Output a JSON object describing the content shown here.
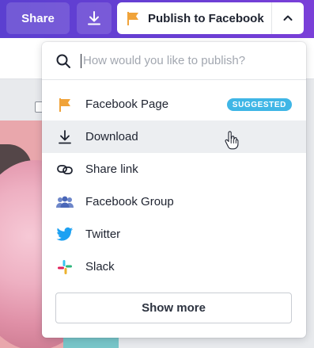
{
  "toolbar": {
    "share_label": "Share",
    "download_icon": "download-icon",
    "publish_label": "Publish to Facebook",
    "publish_icon": "flag-icon",
    "toggle_icon": "chevron-up-icon",
    "accent_color": "#6a3fd4"
  },
  "dropdown": {
    "search": {
      "placeholder": "How would you like to publish?",
      "icon": "search-icon"
    },
    "items": [
      {
        "label": "Facebook Page",
        "icon": "flag-icon",
        "badge": "SUGGESTED"
      },
      {
        "label": "Download",
        "icon": "download-icon",
        "hovered": true
      },
      {
        "label": "Share link",
        "icon": "link-icon"
      },
      {
        "label": "Facebook Group",
        "icon": "group-icon"
      },
      {
        "label": "Twitter",
        "icon": "twitter-icon"
      },
      {
        "label": "Slack",
        "icon": "slack-icon"
      }
    ],
    "show_more_label": "Show more"
  }
}
